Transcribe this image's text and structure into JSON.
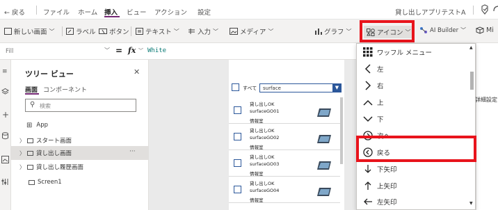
{
  "topbar": {
    "back_label": "← 戻る",
    "menus": [
      "ファイル",
      "ホーム",
      "挿入",
      "ビュー",
      "アクション",
      "設定"
    ],
    "active_menu_index": 2,
    "app_title": "貸し出しアプリテストA"
  },
  "ribbon": {
    "new_screen": "新しい画面",
    "label": "ラベル",
    "button": "ボタン",
    "text": "テキスト",
    "input": "入力",
    "media": "メディア",
    "chart": "グラフ",
    "icons": "アイコン",
    "ai_builder": "AI Builder",
    "mixed_reality": "Mi"
  },
  "formula": {
    "property": "Fill",
    "fx": "fx",
    "value": "White"
  },
  "tree": {
    "title": "ツリー ビュー",
    "tab_screens": "画面",
    "tab_components": "コンポーネント",
    "search_placeholder": "検索",
    "app_label": "App",
    "items": [
      {
        "label": "スタート画面"
      },
      {
        "label": "貸し出し画面"
      },
      {
        "label": "貸し出し履歴画面"
      },
      {
        "label": "Screen1"
      }
    ]
  },
  "canvas": {
    "filter_all": "すべて",
    "filter_value": "surface",
    "gallery": [
      {
        "status": "貸し出しOK",
        "name": "surfaceGO01",
        "dept": "情報室"
      },
      {
        "status": "貸し出しOK",
        "name": "surfaceGO02",
        "dept": "情報室"
      },
      {
        "status": "貸し出しOK",
        "name": "surfaceGO03",
        "dept": "情報室"
      },
      {
        "status": "貸し出しOK",
        "name": "surfaceGO04",
        "dept": "情報室"
      }
    ]
  },
  "right_pane": {
    "label": "詳細設定"
  },
  "icon_menu": {
    "items": [
      {
        "label": "ワッフル メニュー",
        "icon": "waffle-icon",
        "glyph": "▦"
      },
      {
        "label": "左",
        "icon": "chevron-left-icon",
        "glyph": "〈"
      },
      {
        "label": "右",
        "icon": "chevron-right-icon",
        "glyph": "〉"
      },
      {
        "label": "上",
        "icon": "chevron-up-icon",
        "glyph": "︿"
      },
      {
        "label": "下",
        "icon": "chevron-down-icon",
        "glyph": "﹀"
      },
      {
        "label": "次へ",
        "icon": "next-icon",
        "glyph": "⊙"
      },
      {
        "label": "戻る",
        "icon": "back-circle-icon",
        "glyph": "⊙"
      },
      {
        "label": "下矢印",
        "icon": "arrow-down-icon",
        "glyph": "↓"
      },
      {
        "label": "上矢印",
        "icon": "arrow-up-icon",
        "glyph": "↑"
      },
      {
        "label": "左矢印",
        "icon": "arrow-left-icon",
        "glyph": "←"
      }
    ]
  },
  "colors": {
    "highlight_red": "#e8141c",
    "accent_blue": "#0078d4",
    "app_purple": "#742774"
  }
}
